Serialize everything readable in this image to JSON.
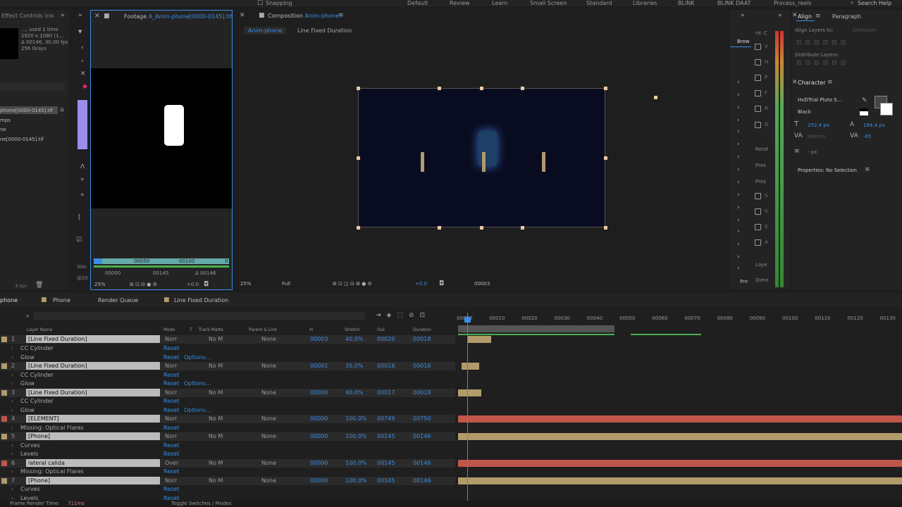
{
  "workspace": {
    "snapping": "Snapping",
    "items": [
      "Default",
      "Review",
      "Learn",
      "Small Screen",
      "Standard",
      "Libraries",
      "BLINK",
      "BLINK DAAT",
      "Process_reels"
    ],
    "search": "Search Help"
  },
  "project": {
    "tab": "Effect Controls (no",
    "info_lines": [
      "..., used 1 time",
      "1920 x 1080 (1...",
      "Δ 00146, 30.00 fps",
      "256 Grays"
    ],
    "items": [
      "phone[0000-0145].tif",
      "mps",
      "ne",
      "ne[0000-0145].tif"
    ],
    "bpc": "8 bpc",
    "voic": "Voic",
    "year": "@20"
  },
  "footage": {
    "tab_prefix": "Footage",
    "tab_name": "A_Anim-phone[0000-0145].tif",
    "ruler_labels": [
      "00050",
      "00100",
      "0"
    ],
    "in_point": "00000",
    "out_point": "00145",
    "duration": "Δ 00146",
    "zoom": "25%",
    "offset": "+0.0"
  },
  "composition": {
    "tab_prefix": "Composition",
    "tab_name": "Anim-phone",
    "crumbs": [
      "Anim-phone",
      "Line Fixed Duration"
    ],
    "zoom": "25%",
    "resolution": "Full",
    "offset": "+0.0",
    "timecode": "00003"
  },
  "right_panels": {
    "top_labels": [
      "rd: C",
      "Brow"
    ],
    "labels": [
      "Rend",
      "Pres",
      "Pres",
      "Laye",
      "Dime",
      "Pre"
    ],
    "check_letters": [
      "V",
      "H",
      "P",
      "F",
      "R",
      "D",
      "S",
      "S",
      "S",
      "A"
    ]
  },
  "align": {
    "tab_align": "Align",
    "tab_paragraph": "Paragraph",
    "align_to_label": "Align Layers to:",
    "align_to_value": "Selection",
    "distribute_label": "Distribute Layers:"
  },
  "character": {
    "title": "Character",
    "font": "HvDTrial Pluto S...",
    "style": "Black",
    "size": "252,4 px",
    "leading": "194,4 px",
    "kerning": "Metrics",
    "tracking": "-65",
    "stroke_unit": "- px",
    "properties": "Properties: No Selection"
  },
  "timeline": {
    "tabs": [
      "phone",
      "Phone",
      "Render Queue",
      "Line Fixed Duration"
    ],
    "search_placeholder": "",
    "columns": {
      "layer_name": "Layer Name",
      "mode": "Mode",
      "t": "T",
      "track_matte": "Track Matte",
      "parent": "Parent & Link",
      "in": "In",
      "stretch": "Stretch",
      "out": "Out",
      "duration": "Duration"
    },
    "ruler": [
      "00000",
      "00010",
      "00020",
      "00030",
      "00040",
      "00050",
      "00060",
      "00070",
      "00080",
      "00090",
      "00100",
      "00110",
      "00120",
      "00130"
    ],
    "rows": [
      {
        "type": "layer",
        "num": "1",
        "name": "[Line Fixed Duration]",
        "mode": "Norr",
        "matte": "No M",
        "parent": "None",
        "in": "00003",
        "stretch": "40,0%",
        "out": "00020",
        "dur": "00018",
        "color": "#b19a6b"
      },
      {
        "type": "fx",
        "name": "CC Cylinder",
        "reset": "Reset",
        "options": ""
      },
      {
        "type": "fx",
        "name": "Glow",
        "reset": "Reset",
        "options": "Options..."
      },
      {
        "type": "layer",
        "num": "2",
        "name": "[Line Fixed Duration]",
        "mode": "Norr",
        "matte": "No M",
        "parent": "None",
        "in": "00001",
        "stretch": "35,0%",
        "out": "00016",
        "dur": "00016",
        "color": "#b19a6b"
      },
      {
        "type": "fx",
        "name": "CC Cylinder",
        "reset": "Reset",
        "options": ""
      },
      {
        "type": "fx",
        "name": "Glow",
        "reset": "Reset",
        "options": "Options..."
      },
      {
        "type": "layer",
        "num": "3",
        "name": "[Line Fixed Duration]",
        "mode": "Norr",
        "matte": "No M",
        "parent": "None",
        "in": "00000",
        "stretch": "40,0%",
        "out": "00017",
        "dur": "00018",
        "color": "#b19a6b"
      },
      {
        "type": "fx",
        "name": "CC Cylinder",
        "reset": "Reset",
        "options": ""
      },
      {
        "type": "fx",
        "name": "Glow",
        "reset": "Reset",
        "options": "Options..."
      },
      {
        "type": "layer",
        "num": "4",
        "name": "[ELEMENT]",
        "mode": "Norr",
        "matte": "No M",
        "parent": "None",
        "in": "00000",
        "stretch": "100,0%",
        "out": "00749",
        "dur": "00750",
        "color": "#c0564b"
      },
      {
        "type": "fx",
        "name": "Missing: Optical Flares",
        "reset": "Reset",
        "options": ""
      },
      {
        "type": "layer",
        "num": "5",
        "name": "[Phone]",
        "mode": "Norr",
        "matte": "No M",
        "parent": "None",
        "in": "00000",
        "stretch": "100,0%",
        "out": "00145",
        "dur": "00146",
        "color": "#b19a6b"
      },
      {
        "type": "fx",
        "name": "Curves",
        "reset": "Reset",
        "options": ""
      },
      {
        "type": "fx",
        "name": "Levels",
        "reset": "Reset",
        "options": ""
      },
      {
        "type": "layer",
        "num": "6",
        "name": "lateral calida",
        "mode": "Over",
        "matte": "No M",
        "parent": "None",
        "in": "00000",
        "stretch": "100,0%",
        "out": "00145",
        "dur": "00146",
        "color": "#c0564b"
      },
      {
        "type": "fx",
        "name": "Missing: Optical Flares",
        "reset": "Reset",
        "options": ""
      },
      {
        "type": "layer",
        "num": "7",
        "name": "[Phone]",
        "mode": "Norr",
        "matte": "No M",
        "parent": "None",
        "in": "00000",
        "stretch": "100,0%",
        "out": "00145",
        "dur": "00146",
        "color": "#b19a6b"
      },
      {
        "type": "fx",
        "name": "Curves",
        "reset": "Reset",
        "options": ""
      },
      {
        "type": "fx",
        "name": "Levels",
        "reset": "Reset",
        "options": ""
      }
    ]
  },
  "status": {
    "render_label": "Frame Render Time:",
    "render_value": "711ms",
    "toggle": "Toggle Switches / Modes"
  },
  "colors": {
    "accent": "#3a8ee6",
    "layer_tan": "#b19a6b",
    "layer_red": "#c0564b",
    "label_purple": "#9b8cf0"
  }
}
